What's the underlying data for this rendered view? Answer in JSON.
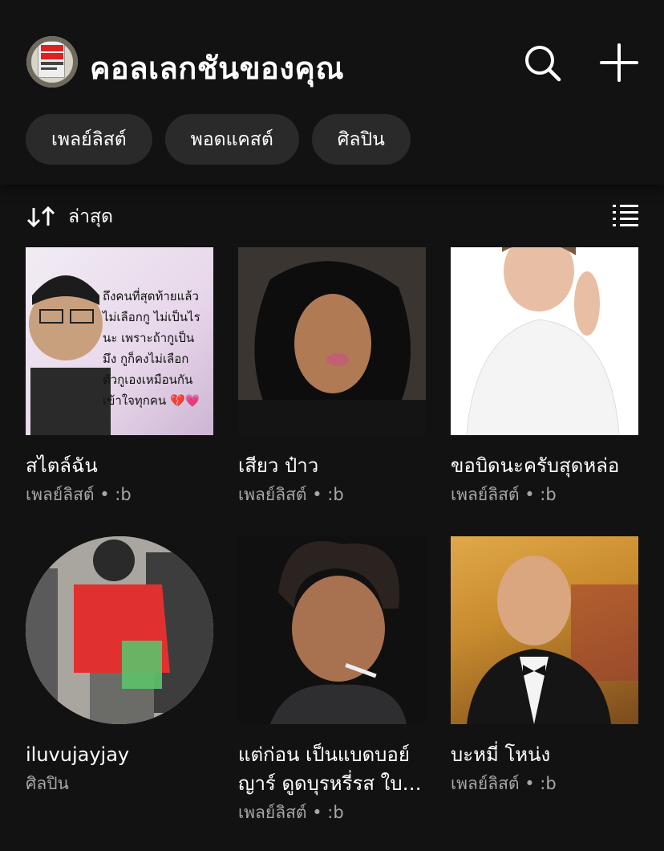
{
  "header": {
    "title": "คอลเลกชันของคุณ",
    "avatar_icon": "profile-avatar",
    "search_icon": "search-icon",
    "add_icon": "plus-icon"
  },
  "filters": [
    {
      "label": "เพลย์ลิสต์"
    },
    {
      "label": "พอดแคสต์"
    },
    {
      "label": "ศิลปิน"
    }
  ],
  "sort": {
    "icon": "sort-arrows-icon",
    "label": "ล่าสุด",
    "view_icon": "list-view-icon"
  },
  "items": [
    {
      "title": "สไตล์ฉัน",
      "subtitle": "เพลย์ลิสต์ • :b",
      "shape": "square"
    },
    {
      "title": "เสียว ป๋าว",
      "subtitle": "เพลย์ลิสต์ • :b",
      "shape": "square"
    },
    {
      "title": "ขอบิดนะครับสุดหล่อ",
      "subtitle": "เพลย์ลิสต์ • :b",
      "shape": "square"
    },
    {
      "title": "iluvujayjay",
      "subtitle": "ศิลปิน",
      "shape": "circle"
    },
    {
      "title": "แต่ก่อน เป็นแบดบอย์ ญาร์ ดูดบุรหรี่รส ใบ…",
      "subtitle": "เพลย์ลิสต์ • :b",
      "shape": "square"
    },
    {
      "title": "บะหมี่ โหน่ง",
      "subtitle": "เพลย์ลิสต์ • :b",
      "shape": "square"
    }
  ],
  "thumb1_overlay": [
    "ถึงคนที่สุดท้ายแล้ว",
    "ไม่เลือกกู ไม่เป็นไร",
    "นะ เพราะถ้ากูเป็น",
    "มึง กูก็คงไม่เลือก",
    "ตัวกูเองเหมือนกัน",
    "เข้าใจทุกคน 💔💗"
  ],
  "colors": {
    "background": "#121212",
    "chip": "#2a2a2a",
    "secondary_text": "#a7a7a7"
  }
}
